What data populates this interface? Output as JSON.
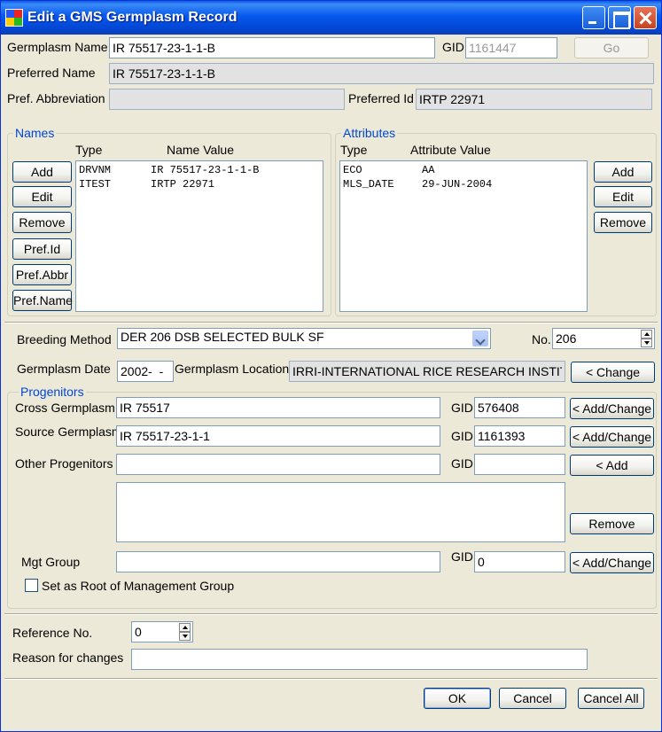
{
  "window": {
    "title": "Edit a GMS Germplasm Record"
  },
  "header": {
    "germplasm_name_label": "Germplasm Name",
    "germplasm_name_value": "IR 75517-23-1-1-B",
    "gid_label": "GID",
    "gid_value": "1161447",
    "go_label": "Go",
    "preferred_name_label": "Preferred Name",
    "preferred_name_value": "IR 75517-23-1-1-B",
    "pref_abbr_label": "Pref. Abbreviation",
    "pref_abbr_value": "",
    "preferred_id_label": "Preferred Id",
    "preferred_id_value": "IRTP 22971"
  },
  "names": {
    "title": "Names",
    "col_type": "Type",
    "col_value": "Name  Value",
    "buttons": {
      "add": "Add",
      "edit": "Edit",
      "remove": "Remove",
      "pref_id": "Pref.Id",
      "pref_abbr": "Pref.Abbr",
      "pref_name": "Pref.Name"
    },
    "rows": [
      {
        "type": "DRVNM",
        "value": "IR 75517-23-1-1-B"
      },
      {
        "type": "ITEST",
        "value": "IRTP 22971"
      }
    ]
  },
  "attributes": {
    "title": "Attributes",
    "col_type": "Type",
    "col_value": "Attribute Value",
    "buttons": {
      "add": "Add",
      "edit": "Edit",
      "remove": "Remove"
    },
    "rows": [
      {
        "type": "ECO",
        "value": "AA"
      },
      {
        "type": "MLS_DATE",
        "value": "29-JUN-2004"
      }
    ]
  },
  "breeding": {
    "method_label": "Breeding Method",
    "method_value": "DER  206 DSB SELECTED BULK SF",
    "no_label": "No.",
    "no_value": "206",
    "date_label": "Germplasm Date",
    "date_value": "2002-  -",
    "location_label": "Germplasm Location",
    "location_value": "IRRI-INTERNATIONAL RICE RESEARCH INSTITU",
    "change_label": "< Change"
  },
  "progenitors": {
    "title": "Progenitors",
    "cross_label": "Cross Germplasm",
    "cross_value": "IR 75517",
    "cross_gid_label": "GID",
    "cross_gid": "576408",
    "cross_btn": "< Add/Change",
    "source_label": "Source Germplasm",
    "source_value": "IR 75517-23-1-1",
    "source_gid_label": "GID",
    "source_gid": "1161393",
    "source_btn": "< Add/Change",
    "other_label": "Other Progenitors",
    "other_value": "",
    "other_gid_label": "GID",
    "other_gid": "",
    "other_btn": "< Add",
    "remove_btn": "Remove",
    "mgt_label": "Mgt Group",
    "mgt_value": "",
    "mgt_gid_label": "GID",
    "mgt_gid": "0",
    "mgt_btn": "< Add/Change",
    "root_label": "Set as Root of Management Group"
  },
  "footer": {
    "ref_label": "Reference No.",
    "ref_value": "0",
    "reason_label": "Reason for changes",
    "reason_value": "",
    "ok": "OK",
    "cancel": "Cancel",
    "cancel_all": "Cancel All"
  }
}
